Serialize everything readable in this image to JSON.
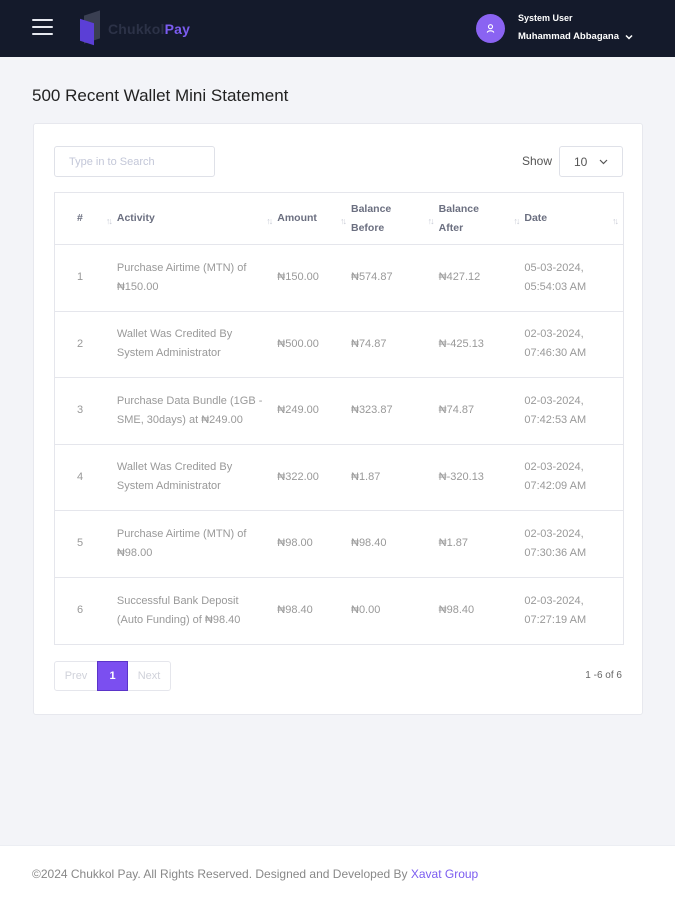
{
  "header": {
    "brand_part1": "Chukkol",
    "brand_part2": "Pay",
    "user_role": "System User",
    "user_name": "Muhammad Abbagana"
  },
  "page": {
    "title": "500 Recent Wallet Mini Statement"
  },
  "controls": {
    "search_placeholder": "Type in to Search",
    "show_label": "Show",
    "show_value": "10"
  },
  "table": {
    "columns": {
      "index": "#",
      "activity": "Activity",
      "amount": "Amount",
      "balance_before_1": "Balance",
      "balance_before_2": "Before",
      "balance_after_1": "Balance",
      "balance_after_2": "After",
      "date": "Date"
    },
    "rows": [
      {
        "index": "1",
        "activity_1": "Purchase Airtime (MTN) of",
        "activity_2": "₦150.00",
        "amount": "₦150.00",
        "before": "₦574.87",
        "after": "₦427.12",
        "date_1": "05-03-2024,",
        "date_2": "05:54:03 AM"
      },
      {
        "index": "2",
        "activity_1": "Wallet Was Credited By",
        "activity_2": "System Administrator",
        "amount": "₦500.00",
        "before": "₦74.87",
        "after": "₦-425.13",
        "date_1": "02-03-2024,",
        "date_2": "07:46:30 AM"
      },
      {
        "index": "3",
        "activity_1": "Purchase Data Bundle (1GB -",
        "activity_2": "SME, 30days) at ₦249.00",
        "amount": "₦249.00",
        "before": "₦323.87",
        "after": "₦74.87",
        "date_1": "02-03-2024,",
        "date_2": "07:42:53 AM"
      },
      {
        "index": "4",
        "activity_1": "Wallet Was Credited By",
        "activity_2": "System Administrator",
        "amount": "₦322.00",
        "before": "₦1.87",
        "after": "₦-320.13",
        "date_1": "02-03-2024,",
        "date_2": "07:42:09 AM"
      },
      {
        "index": "5",
        "activity_1": "Purchase Airtime (MTN) of",
        "activity_2": "₦98.00",
        "amount": "₦98.00",
        "before": "₦98.40",
        "after": "₦1.87",
        "date_1": "02-03-2024,",
        "date_2": "07:30:36 AM"
      },
      {
        "index": "6",
        "activity_1": "Successful Bank Deposit",
        "activity_2": "(Auto Funding) of ₦98.40",
        "amount": "₦98.40",
        "before": "₦0.00",
        "after": "₦98.40",
        "date_1": "02-03-2024,",
        "date_2": "07:27:19 AM"
      }
    ]
  },
  "pagination": {
    "prev": "Prev",
    "current": "1",
    "next": "Next",
    "count": "1 -6 of 6"
  },
  "footer": {
    "text": "©2024 Chukkol Pay. All Rights Reserved. Designed and Developed By ",
    "link": "Xavat Group"
  },
  "icons": {
    "menu": "hamburger-icon",
    "user": "user-icon",
    "chevron": "chevron-down-icon",
    "sort": "sort-icon"
  },
  "colors": {
    "topbar": "#141a2b",
    "accent": "#7b4ff0"
  }
}
